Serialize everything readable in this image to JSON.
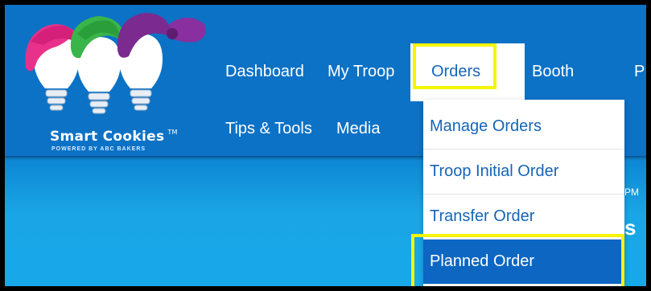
{
  "logo": {
    "name": "Smart Cookies",
    "tm": "TM",
    "tagline": "POWERED BY ABC BAKERS"
  },
  "nav": {
    "dashboard": "Dashboard",
    "my_troop": "My Troop",
    "orders": "Orders",
    "booth": "Booth",
    "tips_tools": "Tips & Tools",
    "media": "Media",
    "clipped_right": "P"
  },
  "orders_menu": {
    "items": [
      "Manage Orders",
      "Troop Initial Order",
      "Transfer Order",
      "Planned Order"
    ],
    "active": "Planned Order"
  },
  "page_fragments": {
    "time_fragment": "PM",
    "letter_fragment": "s"
  },
  "colors": {
    "nav_bg": "#0c72c6",
    "link": "#1565b8",
    "highlight": "#f5f500",
    "active_item": "#0c66c2"
  }
}
